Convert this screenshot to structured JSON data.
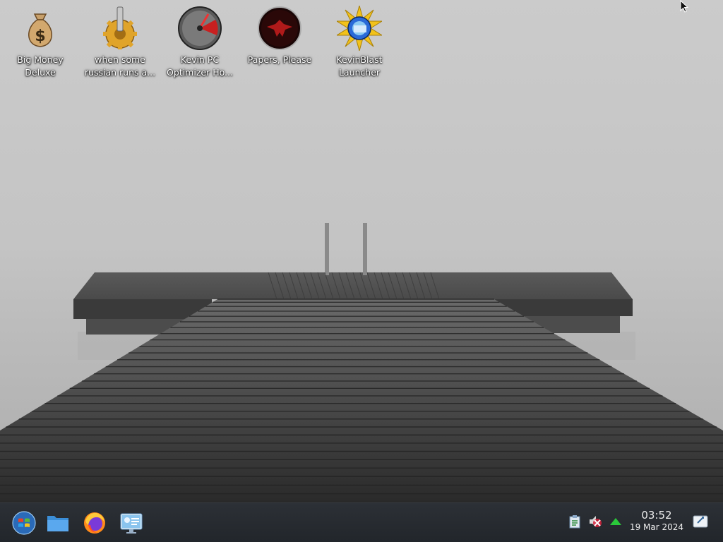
{
  "desktop": {
    "icons": [
      {
        "label": "Big Money\nDeluxe",
        "icon": "money-bag-icon"
      },
      {
        "label": "when some\nrussian runs a...",
        "icon": "golden-gear-icon"
      },
      {
        "label": "Kevin PC\nOptimizer Ho...",
        "icon": "speedometer-gauge-icon"
      },
      {
        "label": "Papers, Please",
        "icon": "red-eagle-emblem-icon"
      },
      {
        "label": "KevinBlast\nLauncher",
        "icon": "sunburst-disc-icon"
      }
    ]
  },
  "taskbar": {
    "pinned": [
      {
        "name": "start-menu",
        "icon": "windows-orb-icon"
      },
      {
        "name": "file-manager",
        "icon": "folder-icon"
      },
      {
        "name": "firefox",
        "icon": "firefox-icon"
      },
      {
        "name": "system-settings",
        "icon": "control-panel-icon"
      }
    ],
    "tray": [
      {
        "name": "clipboard",
        "icon": "clipboard-icon"
      },
      {
        "name": "volume-muted",
        "icon": "speaker-muted-icon"
      },
      {
        "name": "show-hidden",
        "icon": "up-arrow-icon"
      }
    ],
    "clock": {
      "time": "03:52",
      "date": "19 Mar 2024"
    },
    "show_desktop_icon": "show-desktop-icon"
  },
  "colors": {
    "taskbar_bg": "#262a30",
    "label_text": "#ffffff",
    "sky": "#c8c8c8"
  }
}
